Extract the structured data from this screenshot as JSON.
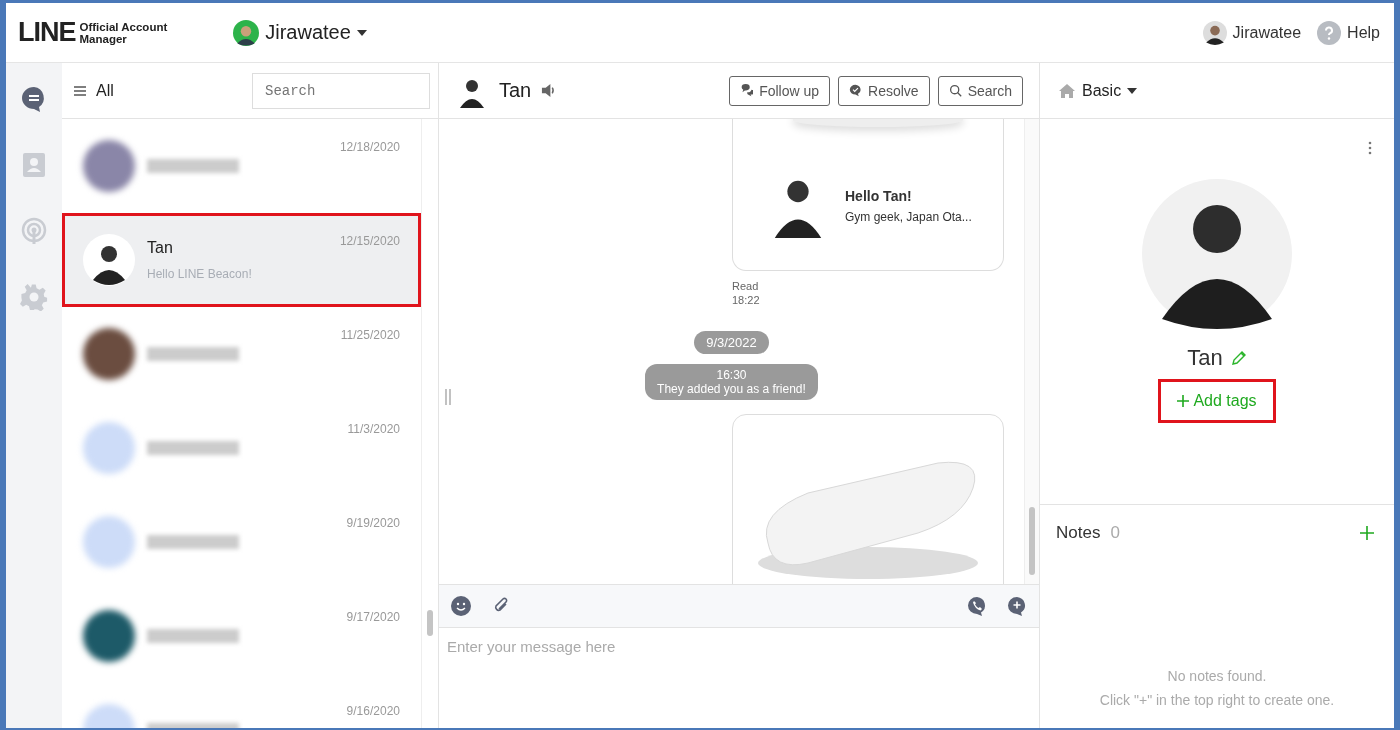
{
  "header": {
    "logo_main": "LINE",
    "logo_sub": [
      "Official Account",
      "Manager"
    ],
    "account": "Jirawatee",
    "user": "Jirawatee",
    "help": "Help"
  },
  "rail": [
    {
      "kind": "chat",
      "selected": true
    },
    {
      "kind": "contacts",
      "selected": false
    },
    {
      "kind": "broadcast",
      "selected": false
    },
    {
      "kind": "settings",
      "selected": false
    }
  ],
  "chat_list": {
    "filter": "All",
    "search_placeholder": "Search",
    "items": [
      {
        "kind": "blurred",
        "date": "12/18/2020",
        "color": "#8a86a8",
        "selected": false,
        "highlighted": false
      },
      {
        "kind": "contact",
        "name": "Tan",
        "preview": "Hello LINE Beacon!",
        "date": "12/15/2020",
        "selected": true,
        "highlighted": true
      },
      {
        "kind": "blurred",
        "date": "11/25/2020",
        "color": "#6b4d40",
        "selected": false,
        "highlighted": false
      },
      {
        "kind": "blurred",
        "date": "11/3/2020",
        "color": "#cddcf8",
        "selected": false,
        "highlighted": false
      },
      {
        "kind": "blurred",
        "date": "9/19/2020",
        "color": "#cddcf8",
        "selected": false,
        "highlighted": false
      },
      {
        "kind": "blurred",
        "date": "9/17/2020",
        "color": "#1d5a68",
        "selected": false,
        "highlighted": false
      },
      {
        "kind": "blurred",
        "date": "9/16/2020",
        "color": "#cddcf8",
        "selected": false,
        "highlighted": false
      }
    ]
  },
  "chat": {
    "contact_name": "Tan",
    "buttons": [
      {
        "kind": "follow",
        "label": "Follow up"
      },
      {
        "kind": "resolve",
        "label": "Resolve"
      },
      {
        "kind": "search",
        "label": "Search"
      }
    ],
    "messages": [
      {
        "kind": "card",
        "title": "Hello Tan!",
        "subtitle": "Gym geek, Japan Ota..."
      },
      {
        "kind": "read",
        "label": "Read",
        "time": "18:22"
      },
      {
        "kind": "date",
        "text": "9/3/2022"
      },
      {
        "kind": "system",
        "time": "16:30",
        "text": "They added you as a friend!"
      },
      {
        "kind": "image"
      }
    ],
    "composer_placeholder": "Enter your message here"
  },
  "profile": {
    "view": "Basic",
    "name": "Tan",
    "add_tags": {
      "label": "Add tags",
      "highlighted": true
    },
    "notes": {
      "title": "Notes",
      "count": "0",
      "empty": [
        "No notes found.",
        "Click \"+\" in the top right to create one."
      ]
    }
  }
}
